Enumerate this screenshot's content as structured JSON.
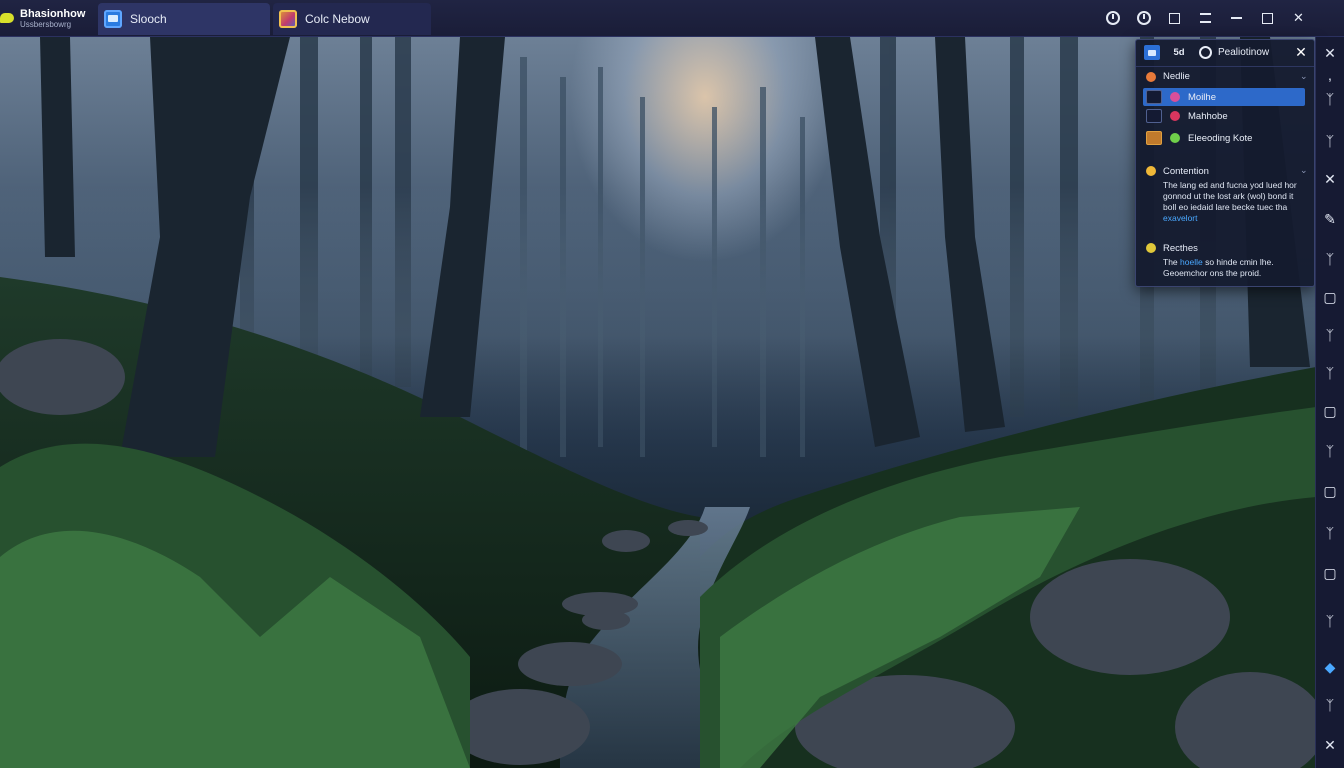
{
  "app": {
    "name": "Bhasionhow",
    "subtitle": "Ussbersbowrg"
  },
  "tabs": [
    {
      "label": "Slooch",
      "icon": "window-icon",
      "active": true
    },
    {
      "label": "Colc Nebow",
      "icon": "photo-icon",
      "active": false
    }
  ],
  "window_controls": [
    "power-icon",
    "power-icon",
    "square-icon",
    "equals-icon",
    "minimize-icon",
    "maximize-icon",
    "close-icon"
  ],
  "panel": {
    "header": {
      "num": "5d",
      "title": "Pealiotinow"
    },
    "section1": {
      "title": "Nedlie",
      "items": [
        {
          "label": "Moilhe",
          "selected": true,
          "dot_color": "#d94f9a"
        },
        {
          "label": "Mahhobe",
          "selected": false,
          "dot_color": "#d9365f"
        },
        {
          "label": "Eleeoding Kote",
          "selected": false,
          "dot_color": "#6fcf4a"
        }
      ]
    },
    "section2": {
      "title": "Contention",
      "text": "The lang ed and fucna yod lued hor gonnod ut the lost ark (wol) bond it boll eo iedaid lare becke tuec tha",
      "link": "exavelort"
    },
    "section3": {
      "title": "Recthes",
      "text_pre": "The",
      "link": "hoelle",
      "text_post": "so hinde cmin lhe. Geoemchor ons the proid."
    }
  },
  "side_strip": {
    "icons": [
      "close-icon",
      "comma-icon",
      "tree-icon",
      "tree-icon",
      "cross-icon",
      "pen-icon",
      "tree-icon",
      "frame-icon",
      "tree-icon",
      "tree-icon",
      "frame-icon",
      "tree-icon",
      "frame-icon",
      "tree-icon",
      "frame-icon",
      "tree-icon",
      "droplet-icon",
      "tree-icon",
      "close-icon"
    ]
  },
  "colors": {
    "titlebar": "#1d2040",
    "tab_active": "#2e3566",
    "selected_row": "#2d69c9",
    "link": "#4aa8ff"
  }
}
